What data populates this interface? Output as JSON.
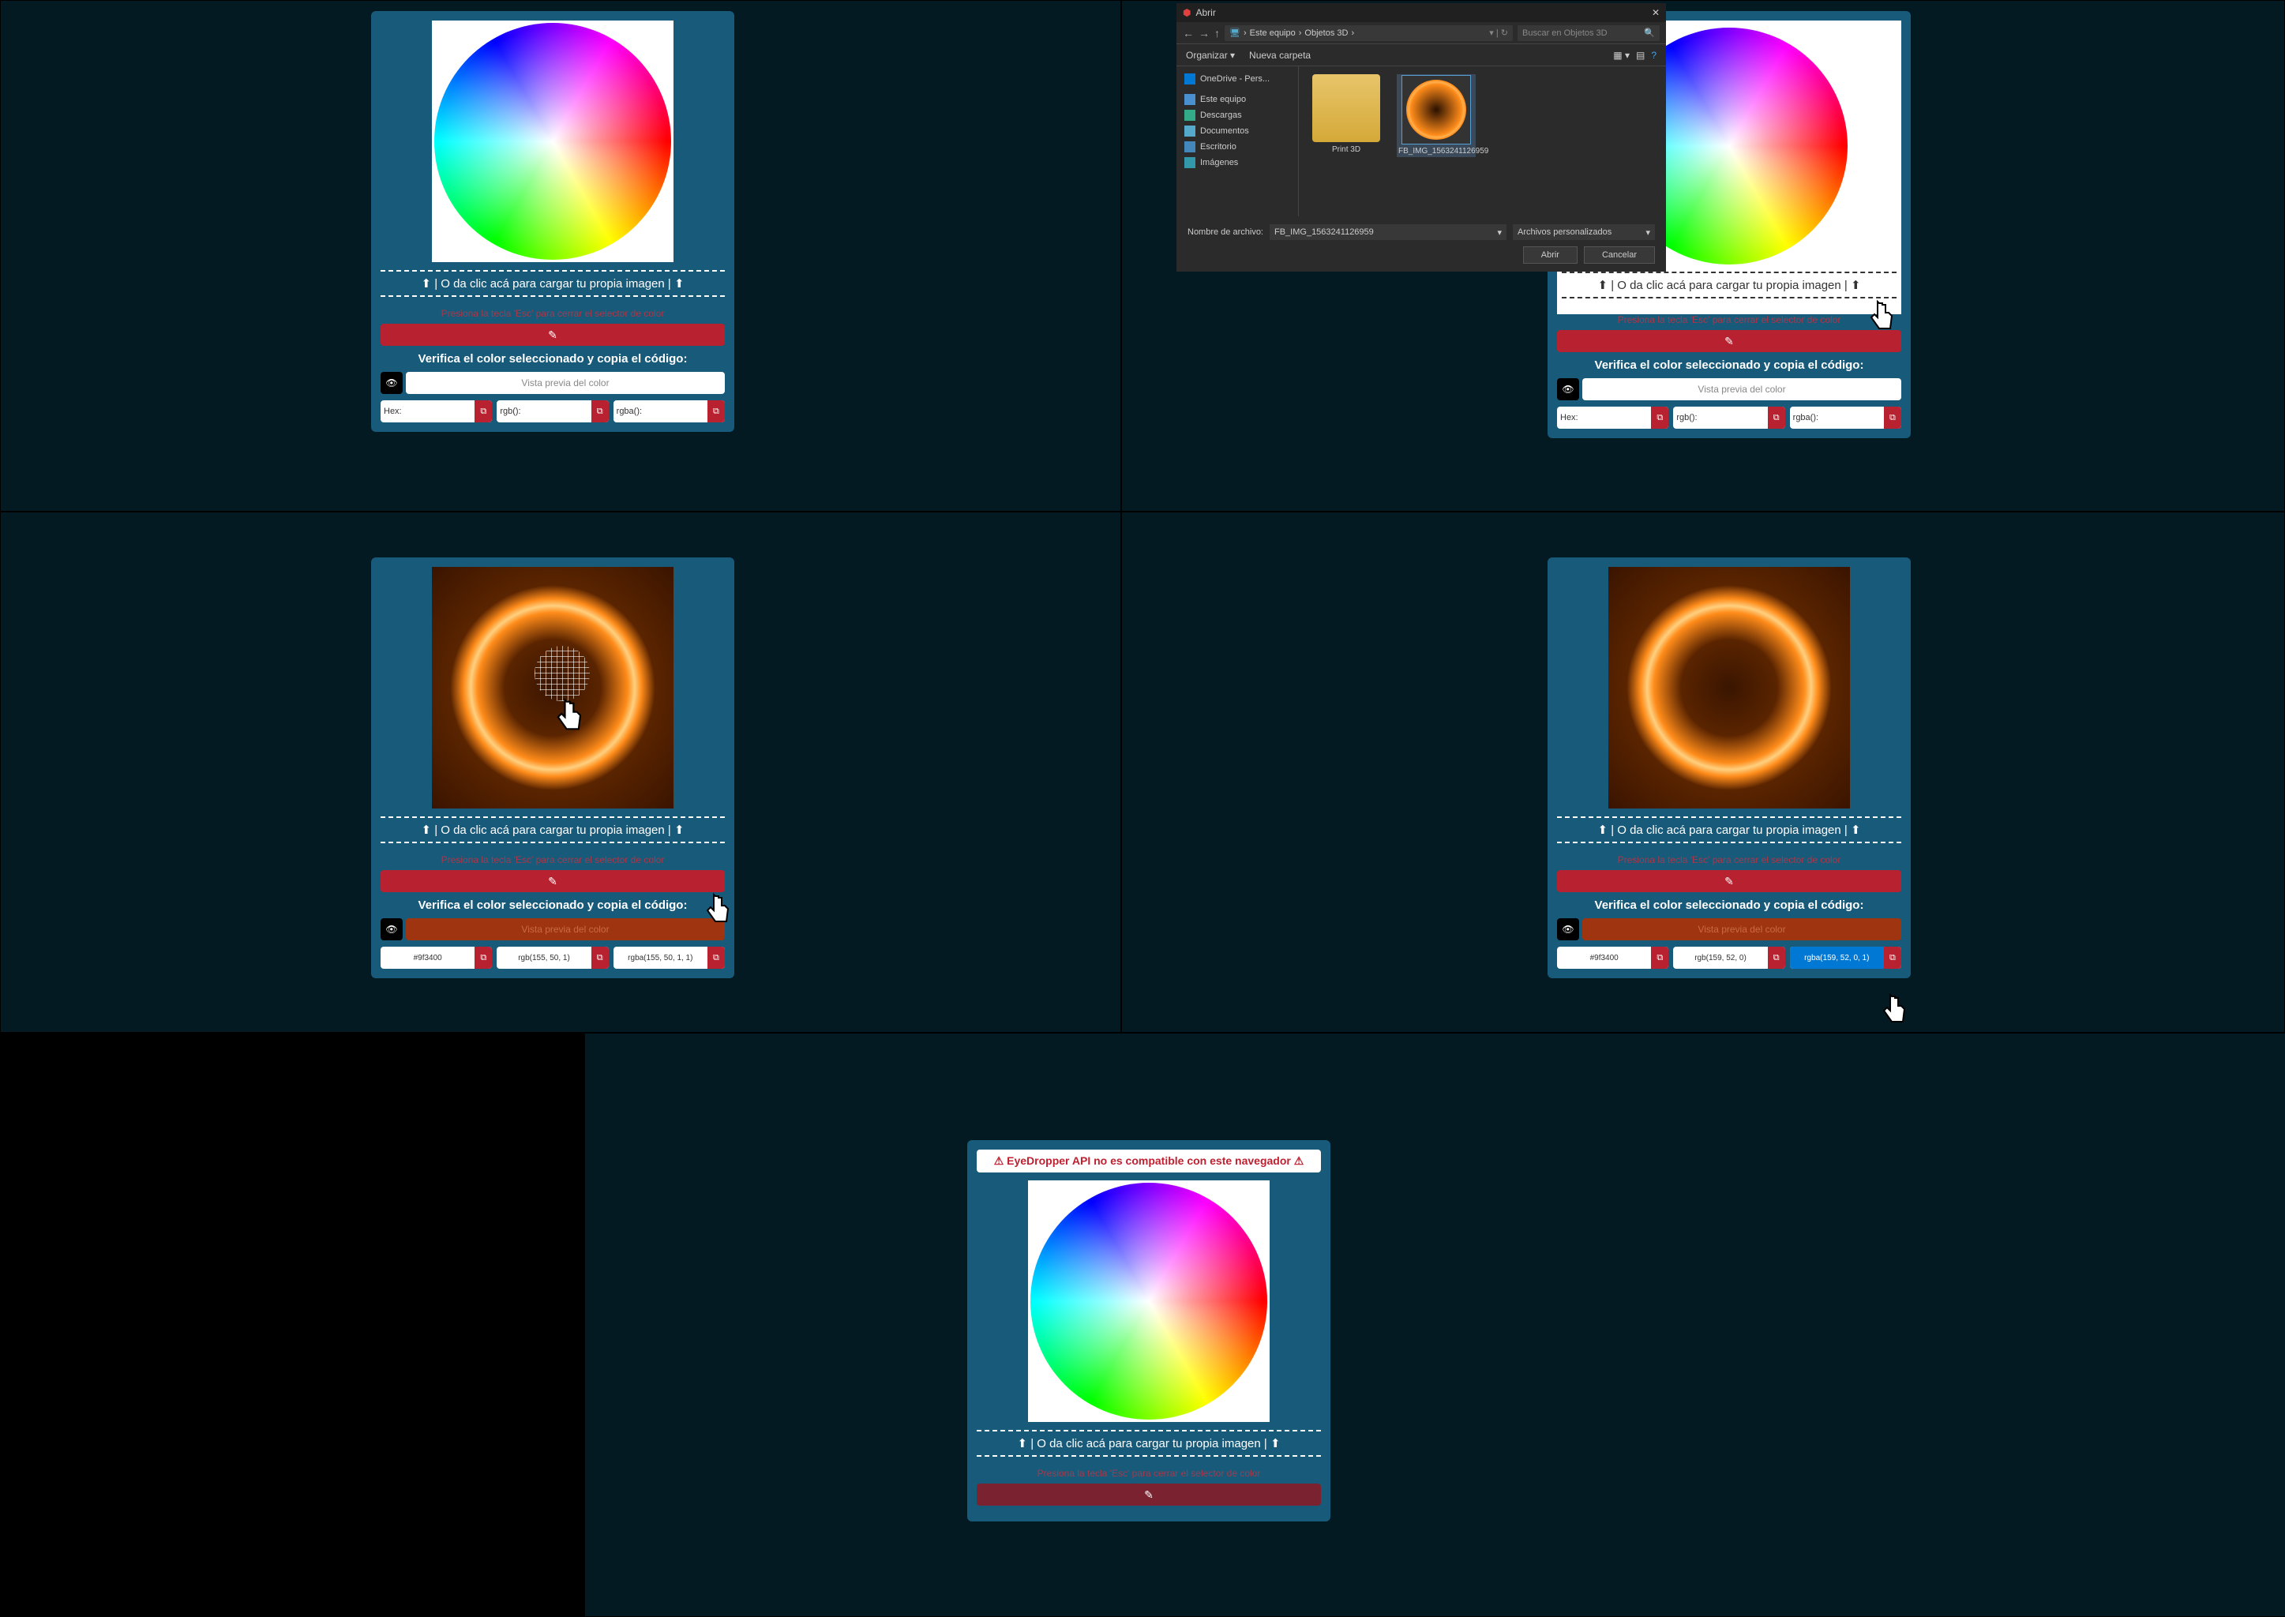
{
  "panel": {
    "upload_text": "⬆ | O da clic acá para cargar tu propia imagen | ⬆",
    "esc_text": "Presiona la tecla 'Esc' para cerrar el selector de color",
    "verify_text": "Verifica el color seleccionado y copia el código:",
    "preview_placeholder": "Vista previa del color",
    "labels": {
      "hex": "Hex:",
      "rgb": "rgb():",
      "rgba": "rgba():"
    },
    "alert": "⚠ EyeDropper API no es compatible con este navegador ⚠"
  },
  "sampled": {
    "hex": "#9f3400",
    "rgb": "rgb(155, 50, 1)",
    "rgba": "rgba(155, 50, 1, 1)"
  },
  "sampled4": {
    "hex": "#9f3400",
    "rgb": "rgb(159, 52, 0)",
    "rgba": "rgba(159, 52, 0, 1)"
  },
  "file_dialog": {
    "title": "Abrir",
    "path_parts": [
      "Este equipo",
      "Objetos 3D"
    ],
    "search_placeholder": "Buscar en Objetos 3D",
    "organize": "Organizar ▾",
    "new_folder": "Nueva carpeta",
    "sidebar": [
      {
        "icon": "cloud",
        "label": "OneDrive - Pers..."
      },
      {
        "icon": "pc",
        "label": "Este equipo"
      },
      {
        "icon": "down",
        "label": "Descargas"
      },
      {
        "icon": "doc",
        "label": "Documentos"
      },
      {
        "icon": "desk",
        "label": "Escritorio"
      },
      {
        "icon": "img",
        "label": "Imágenes"
      }
    ],
    "items": [
      {
        "type": "folder",
        "label": "Print 3D"
      },
      {
        "type": "image",
        "label": "FB_IMG_1563241126959"
      }
    ],
    "filename_label": "Nombre de archivo:",
    "filename_value": "FB_IMG_1563241126959",
    "filter": "Archivos personalizados",
    "open": "Abrir",
    "cancel": "Cancelar"
  }
}
